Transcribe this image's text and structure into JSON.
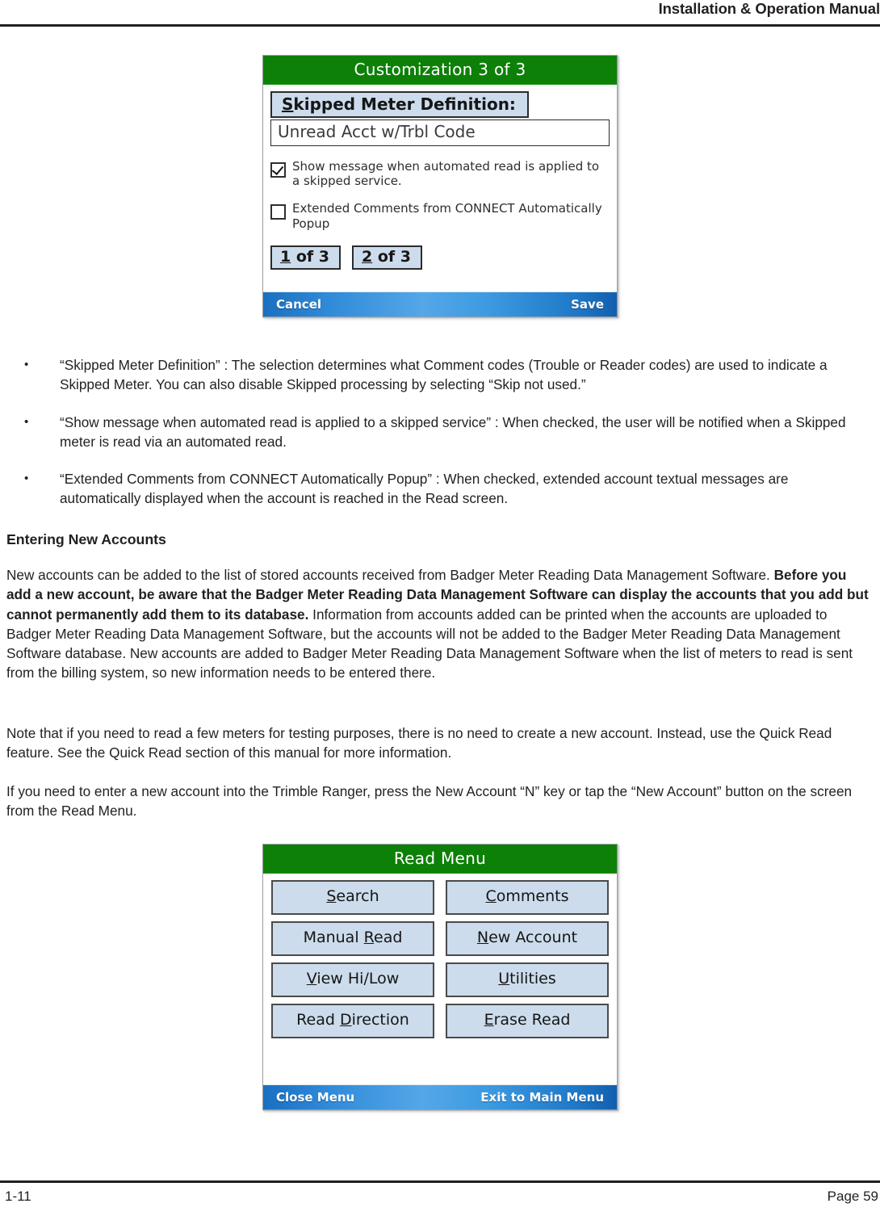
{
  "header": {
    "title": "Installation & Operation Manual"
  },
  "customization_screen": {
    "title": "Customization 3 of 3",
    "field": {
      "label_prefix": "S",
      "label_rest": "kipped Meter Definition:",
      "value": "Unread Acct w/Trbl Code"
    },
    "checkboxes": [
      {
        "checked": true,
        "label": "Show message when automated read is applied to a skipped service."
      },
      {
        "checked": false,
        "label": "Extended Comments from CONNECT Automatically Popup"
      }
    ],
    "pager_buttons": [
      {
        "accel": "1",
        "rest": " of 3"
      },
      {
        "accel": "2",
        "rest": " of 3"
      }
    ],
    "footer": {
      "cancel_label": "Cancel",
      "save_label": "Save"
    },
    "colors": {
      "title_bar": "#0d8008",
      "footer_bar": "#2f8ad8",
      "field_fill": "#ccdcec"
    }
  },
  "bullets": [
    {
      "marker": "•",
      "text": "“Skipped Meter Definition” : The selection determines what Comment codes (Trouble or Reader codes) are used to indicate a Skipped Meter.  You can also disable Skipped processing by selecting “Skip not used.”"
    },
    {
      "marker": "•",
      "text": "“Show message when automated read is applied to a skipped service” : When checked, the user will be notified when a Skipped meter is read via an automated read."
    },
    {
      "marker": "•",
      "text": "“Extended Comments from CONNECT Automatically Popup” : When checked, extended account textual messages are automatically displayed when the account is reached in the Read screen."
    }
  ],
  "section": {
    "heading": "Entering New Accounts",
    "paragraph_1_part_1": "New accounts can be added to the list of stored accounts received from Badger Meter Reading Data Management Software. ",
    "paragraph_1_bold": "Before you add a new account, be aware that the Badger Meter Reading Data Management Software can display the accounts that you add but cannot permanently add them to its database.",
    "paragraph_1_part_2": "  Information from accounts added can be printed when the accounts are uploaded to Badger Meter Reading Data Management Software, but the accounts will not be added to the Badger Meter Reading Data Management Software database.  New accounts are added to Badger Meter Reading Data Management Software when the list of meters to read is sent from the billing system, so new information needs to be entered there.",
    "paragraph_2": "Note that if you need to read a few meters for testing purposes, there is no need to create a new account.  Instead, use the Quick Read feature.  See the Quick Read section of this manual for more information.",
    "paragraph_3": "If you need to enter a new account into the Trimble Ranger, press the New Account “N” key or tap the “New Account” button on the screen from the Read Menu."
  },
  "read_menu_screen": {
    "title": "Read Menu",
    "buttons": [
      {
        "accel": "S",
        "rest": "earch"
      },
      {
        "accel": "C",
        "rest": "omments",
        "pre": ""
      },
      {
        "accel": "R",
        "rest": "ead",
        "pre": "Manual "
      },
      {
        "accel": "N",
        "rest": "ew Account"
      },
      {
        "accel": "V",
        "rest": "iew Hi/Low"
      },
      {
        "accel": "U",
        "rest": "tilities"
      },
      {
        "accel": "D",
        "rest": "irection",
        "pre": "Read "
      },
      {
        "accel": "E",
        "rest": "rase Read"
      }
    ],
    "footer": {
      "close_label": "Close Menu",
      "exit_label": "Exit to Main Menu"
    }
  },
  "footer": {
    "left": "1-11",
    "right": "Page 59"
  }
}
